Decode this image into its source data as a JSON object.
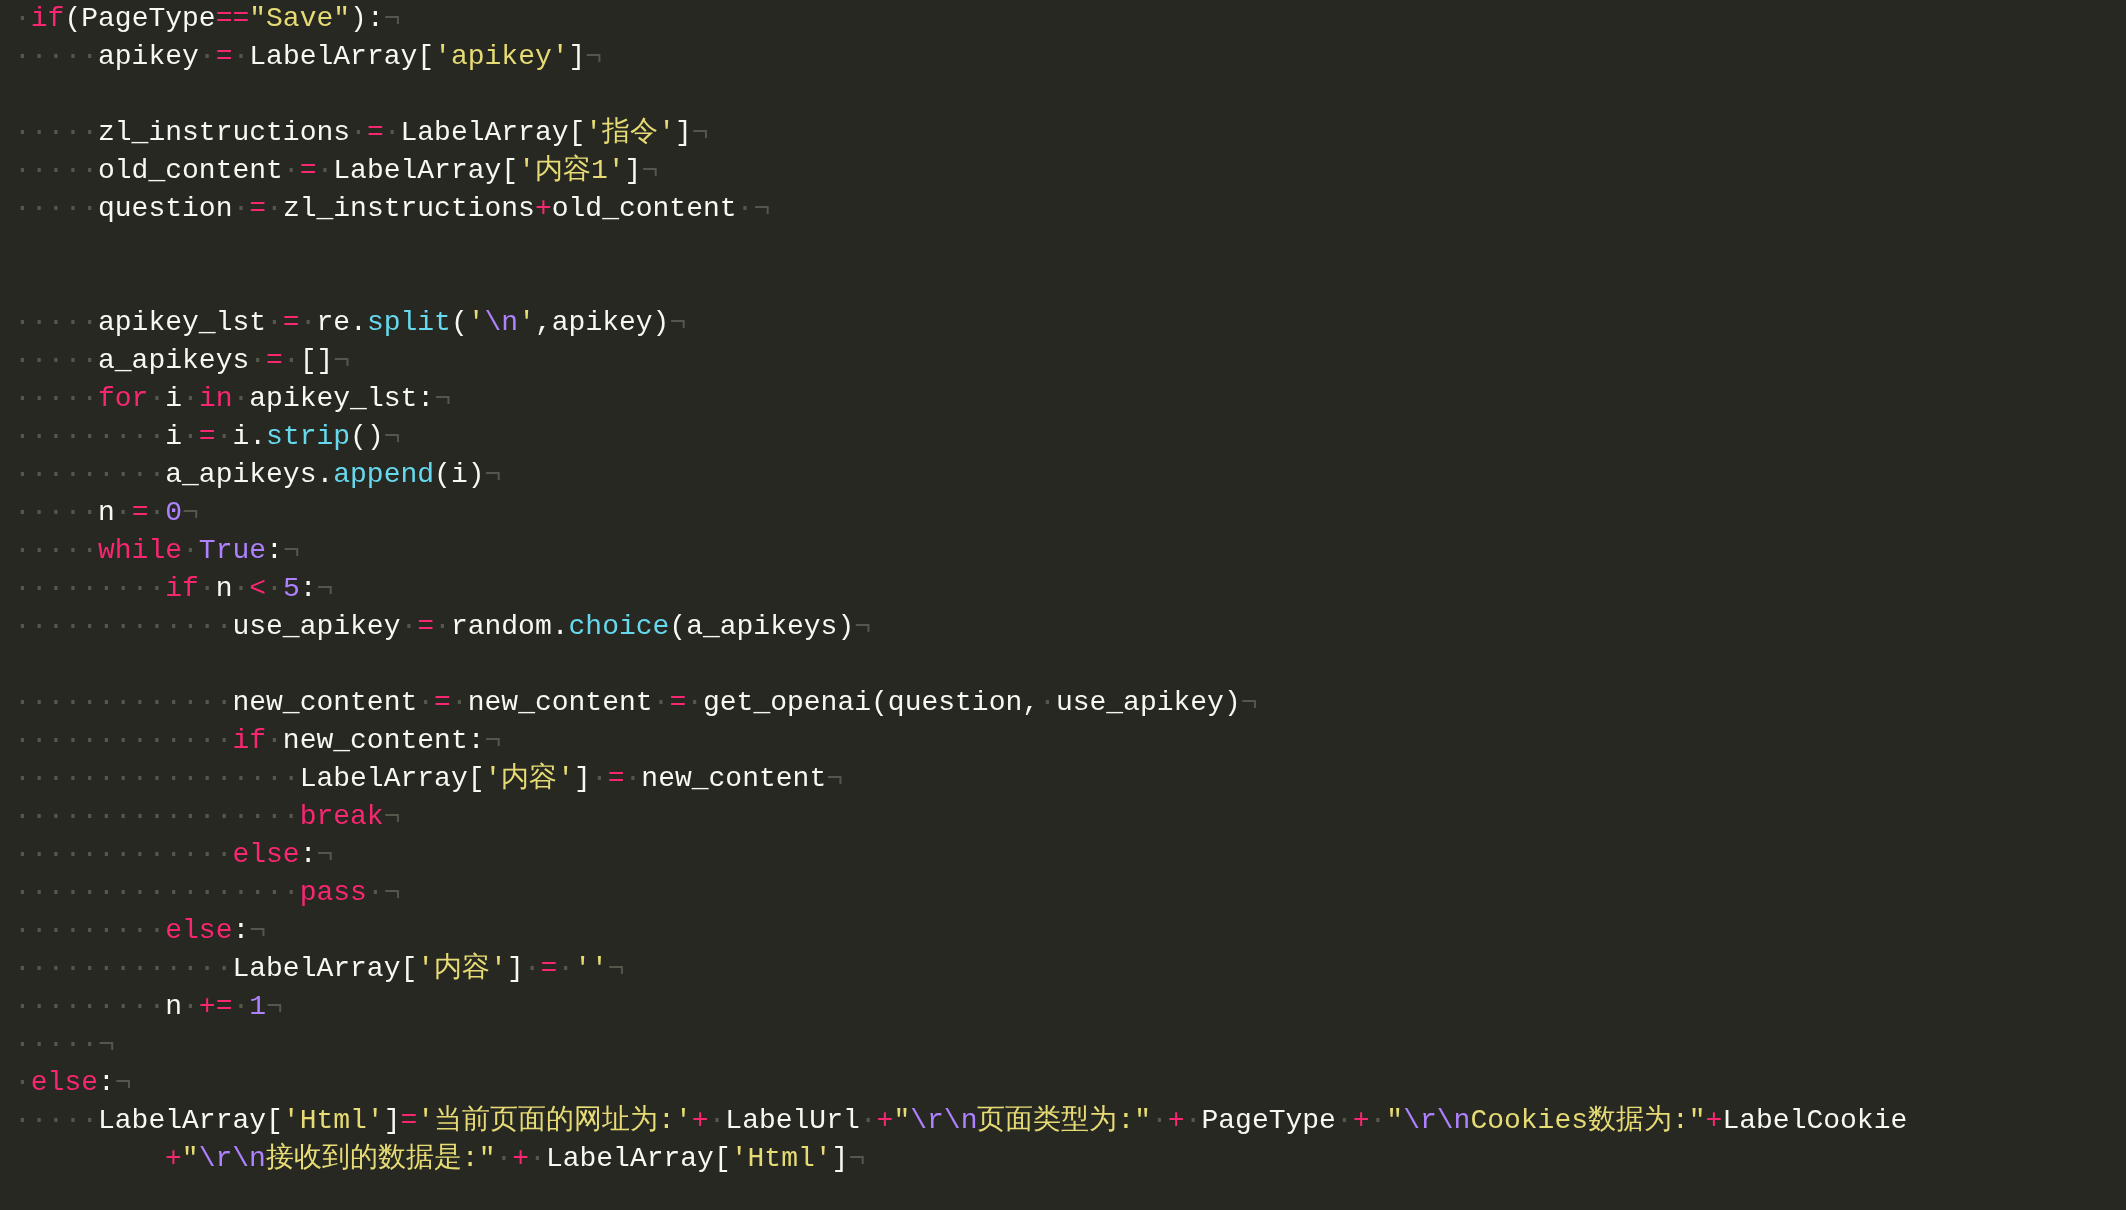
{
  "editor": {
    "lines": [
      {
        "kind": "code",
        "tokens": [
          {
            "kind": "ws",
            "text": "·"
          },
          {
            "kind": "kw",
            "text": "if"
          },
          {
            "kind": "txt",
            "text": "(PageType"
          },
          {
            "kind": "kw",
            "text": "=="
          },
          {
            "kind": "str",
            "text": "\"Save\""
          },
          {
            "kind": "txt",
            "text": "):"
          },
          {
            "kind": "eol",
            "text": "¬"
          }
        ]
      },
      {
        "kind": "code",
        "tokens": [
          {
            "kind": "ws",
            "text": "·····"
          },
          {
            "kind": "txt",
            "text": "apikey"
          },
          {
            "kind": "ws",
            "text": "·"
          },
          {
            "kind": "kw",
            "text": "="
          },
          {
            "kind": "ws",
            "text": "·"
          },
          {
            "kind": "txt",
            "text": "LabelArray["
          },
          {
            "kind": "str",
            "text": "'apikey'"
          },
          {
            "kind": "txt",
            "text": "]"
          },
          {
            "kind": "eol",
            "text": "¬"
          }
        ]
      },
      {
        "kind": "blank"
      },
      {
        "kind": "code",
        "tokens": [
          {
            "kind": "ws",
            "text": "·····"
          },
          {
            "kind": "txt",
            "text": "zl_instructions"
          },
          {
            "kind": "ws",
            "text": "·"
          },
          {
            "kind": "kw",
            "text": "="
          },
          {
            "kind": "ws",
            "text": "·"
          },
          {
            "kind": "txt",
            "text": "LabelArray["
          },
          {
            "kind": "str",
            "text": "'指令'"
          },
          {
            "kind": "txt",
            "text": "]"
          },
          {
            "kind": "eol",
            "text": "¬"
          }
        ]
      },
      {
        "kind": "code",
        "tokens": [
          {
            "kind": "ws",
            "text": "·····"
          },
          {
            "kind": "txt",
            "text": "old_content"
          },
          {
            "kind": "ws",
            "text": "·"
          },
          {
            "kind": "kw",
            "text": "="
          },
          {
            "kind": "ws",
            "text": "·"
          },
          {
            "kind": "txt",
            "text": "LabelArray["
          },
          {
            "kind": "str",
            "text": "'内容1'"
          },
          {
            "kind": "txt",
            "text": "]"
          },
          {
            "kind": "eol",
            "text": "¬"
          }
        ]
      },
      {
        "kind": "code",
        "tokens": [
          {
            "kind": "ws",
            "text": "·····"
          },
          {
            "kind": "txt",
            "text": "question"
          },
          {
            "kind": "ws",
            "text": "·"
          },
          {
            "kind": "kw",
            "text": "="
          },
          {
            "kind": "ws",
            "text": "·"
          },
          {
            "kind": "txt",
            "text": "zl_instructions"
          },
          {
            "kind": "kw",
            "text": "+"
          },
          {
            "kind": "txt",
            "text": "old_content"
          },
          {
            "kind": "ws",
            "text": "·"
          },
          {
            "kind": "eol",
            "text": "¬"
          }
        ]
      },
      {
        "kind": "blank"
      },
      {
        "kind": "blank"
      },
      {
        "kind": "code",
        "tokens": [
          {
            "kind": "ws",
            "text": "·····"
          },
          {
            "kind": "txt",
            "text": "apikey_lst"
          },
          {
            "kind": "ws",
            "text": "·"
          },
          {
            "kind": "kw",
            "text": "="
          },
          {
            "kind": "ws",
            "text": "·"
          },
          {
            "kind": "txt",
            "text": "re."
          },
          {
            "kind": "fn",
            "text": "split"
          },
          {
            "kind": "txt",
            "text": "("
          },
          {
            "kind": "str",
            "text": "'"
          },
          {
            "kind": "num",
            "text": "\\n"
          },
          {
            "kind": "str",
            "text": "'"
          },
          {
            "kind": "txt",
            "text": ",apikey)"
          },
          {
            "kind": "eol",
            "text": "¬"
          }
        ]
      },
      {
        "kind": "code",
        "tokens": [
          {
            "kind": "ws",
            "text": "·····"
          },
          {
            "kind": "txt",
            "text": "a_apikeys"
          },
          {
            "kind": "ws",
            "text": "·"
          },
          {
            "kind": "kw",
            "text": "="
          },
          {
            "kind": "ws",
            "text": "·"
          },
          {
            "kind": "txt",
            "text": "[]"
          },
          {
            "kind": "eol",
            "text": "¬"
          }
        ]
      },
      {
        "kind": "code",
        "tokens": [
          {
            "kind": "ws",
            "text": "·····"
          },
          {
            "kind": "kw",
            "text": "for"
          },
          {
            "kind": "ws",
            "text": "·"
          },
          {
            "kind": "txt",
            "text": "i"
          },
          {
            "kind": "ws",
            "text": "·"
          },
          {
            "kind": "kw",
            "text": "in"
          },
          {
            "kind": "ws",
            "text": "·"
          },
          {
            "kind": "txt",
            "text": "apikey_lst:"
          },
          {
            "kind": "eol",
            "text": "¬"
          }
        ]
      },
      {
        "kind": "code",
        "tokens": [
          {
            "kind": "ws",
            "text": "·········"
          },
          {
            "kind": "txt",
            "text": "i"
          },
          {
            "kind": "ws",
            "text": "·"
          },
          {
            "kind": "kw",
            "text": "="
          },
          {
            "kind": "ws",
            "text": "·"
          },
          {
            "kind": "txt",
            "text": "i."
          },
          {
            "kind": "fn",
            "text": "strip"
          },
          {
            "kind": "txt",
            "text": "()"
          },
          {
            "kind": "eol",
            "text": "¬"
          }
        ]
      },
      {
        "kind": "code",
        "tokens": [
          {
            "kind": "ws",
            "text": "·········"
          },
          {
            "kind": "txt",
            "text": "a_apikeys."
          },
          {
            "kind": "fn",
            "text": "append"
          },
          {
            "kind": "txt",
            "text": "(i)"
          },
          {
            "kind": "eol",
            "text": "¬"
          }
        ]
      },
      {
        "kind": "code",
        "tokens": [
          {
            "kind": "ws",
            "text": "·····"
          },
          {
            "kind": "txt",
            "text": "n"
          },
          {
            "kind": "ws",
            "text": "·"
          },
          {
            "kind": "kw",
            "text": "="
          },
          {
            "kind": "ws",
            "text": "·"
          },
          {
            "kind": "num",
            "text": "0"
          },
          {
            "kind": "eol",
            "text": "¬"
          }
        ]
      },
      {
        "kind": "code",
        "tokens": [
          {
            "kind": "ws",
            "text": "·····"
          },
          {
            "kind": "kw",
            "text": "while"
          },
          {
            "kind": "ws",
            "text": "·"
          },
          {
            "kind": "num",
            "text": "True"
          },
          {
            "kind": "txt",
            "text": ":"
          },
          {
            "kind": "eol",
            "text": "¬"
          }
        ]
      },
      {
        "kind": "code",
        "tokens": [
          {
            "kind": "ws",
            "text": "·········"
          },
          {
            "kind": "kw",
            "text": "if"
          },
          {
            "kind": "ws",
            "text": "·"
          },
          {
            "kind": "txt",
            "text": "n"
          },
          {
            "kind": "ws",
            "text": "·"
          },
          {
            "kind": "kw",
            "text": "<"
          },
          {
            "kind": "ws",
            "text": "·"
          },
          {
            "kind": "num",
            "text": "5"
          },
          {
            "kind": "txt",
            "text": ":"
          },
          {
            "kind": "eol",
            "text": "¬"
          }
        ]
      },
      {
        "kind": "code",
        "tokens": [
          {
            "kind": "ws",
            "text": "·············"
          },
          {
            "kind": "txt",
            "text": "use_apikey"
          },
          {
            "kind": "ws",
            "text": "·"
          },
          {
            "kind": "kw",
            "text": "="
          },
          {
            "kind": "ws",
            "text": "·"
          },
          {
            "kind": "txt",
            "text": "random."
          },
          {
            "kind": "fn",
            "text": "choice"
          },
          {
            "kind": "txt",
            "text": "(a_apikeys)"
          },
          {
            "kind": "eol",
            "text": "¬"
          }
        ]
      },
      {
        "kind": "blank"
      },
      {
        "kind": "code",
        "tokens": [
          {
            "kind": "ws",
            "text": "·············"
          },
          {
            "kind": "txt",
            "text": "new_content"
          },
          {
            "kind": "ws",
            "text": "·"
          },
          {
            "kind": "kw",
            "text": "="
          },
          {
            "kind": "ws",
            "text": "·"
          },
          {
            "kind": "txt",
            "text": "new_content"
          },
          {
            "kind": "ws",
            "text": "·"
          },
          {
            "kind": "kw",
            "text": "="
          },
          {
            "kind": "ws",
            "text": "·"
          },
          {
            "kind": "txt",
            "text": "get_openai(question,"
          },
          {
            "kind": "ws",
            "text": "·"
          },
          {
            "kind": "txt",
            "text": "use_apikey)"
          },
          {
            "kind": "eol",
            "text": "¬"
          }
        ]
      },
      {
        "kind": "code",
        "tokens": [
          {
            "kind": "ws",
            "text": "·············"
          },
          {
            "kind": "kw",
            "text": "if"
          },
          {
            "kind": "ws",
            "text": "·"
          },
          {
            "kind": "txt",
            "text": "new_content:"
          },
          {
            "kind": "eol",
            "text": "¬"
          }
        ]
      },
      {
        "kind": "code",
        "tokens": [
          {
            "kind": "ws",
            "text": "·················"
          },
          {
            "kind": "txt",
            "text": "LabelArray["
          },
          {
            "kind": "str",
            "text": "'内容'"
          },
          {
            "kind": "txt",
            "text": "]"
          },
          {
            "kind": "ws",
            "text": "·"
          },
          {
            "kind": "kw",
            "text": "="
          },
          {
            "kind": "ws",
            "text": "·"
          },
          {
            "kind": "txt",
            "text": "new_content"
          },
          {
            "kind": "eol",
            "text": "¬"
          }
        ]
      },
      {
        "kind": "code",
        "tokens": [
          {
            "kind": "ws",
            "text": "·················"
          },
          {
            "kind": "kw",
            "text": "break"
          },
          {
            "kind": "eol",
            "text": "¬"
          }
        ]
      },
      {
        "kind": "code",
        "tokens": [
          {
            "kind": "ws",
            "text": "·············"
          },
          {
            "kind": "kw",
            "text": "else"
          },
          {
            "kind": "txt",
            "text": ":"
          },
          {
            "kind": "eol",
            "text": "¬"
          }
        ]
      },
      {
        "kind": "code",
        "tokens": [
          {
            "kind": "ws",
            "text": "·················"
          },
          {
            "kind": "kw",
            "text": "pass"
          },
          {
            "kind": "ws",
            "text": "·"
          },
          {
            "kind": "eol",
            "text": "¬"
          }
        ]
      },
      {
        "kind": "code",
        "tokens": [
          {
            "kind": "ws",
            "text": "·········"
          },
          {
            "kind": "kw",
            "text": "else"
          },
          {
            "kind": "txt",
            "text": ":"
          },
          {
            "kind": "eol",
            "text": "¬"
          }
        ]
      },
      {
        "kind": "code",
        "tokens": [
          {
            "kind": "ws",
            "text": "·············"
          },
          {
            "kind": "txt",
            "text": "LabelArray["
          },
          {
            "kind": "str",
            "text": "'内容'"
          },
          {
            "kind": "txt",
            "text": "]"
          },
          {
            "kind": "ws",
            "text": "·"
          },
          {
            "kind": "kw",
            "text": "="
          },
          {
            "kind": "ws",
            "text": "·"
          },
          {
            "kind": "str",
            "text": "''"
          },
          {
            "kind": "eol",
            "text": "¬"
          }
        ]
      },
      {
        "kind": "code",
        "tokens": [
          {
            "kind": "ws",
            "text": "·········"
          },
          {
            "kind": "txt",
            "text": "n"
          },
          {
            "kind": "ws",
            "text": "·"
          },
          {
            "kind": "kw",
            "text": "+="
          },
          {
            "kind": "ws",
            "text": "·"
          },
          {
            "kind": "num",
            "text": "1"
          },
          {
            "kind": "eol",
            "text": "¬"
          }
        ]
      },
      {
        "kind": "code",
        "tokens": [
          {
            "kind": "ws",
            "text": "·····"
          },
          {
            "kind": "eol",
            "text": "¬"
          }
        ]
      },
      {
        "kind": "code",
        "tokens": [
          {
            "kind": "ws",
            "text": "·"
          },
          {
            "kind": "kw",
            "text": "else"
          },
          {
            "kind": "txt",
            "text": ":"
          },
          {
            "kind": "eol",
            "text": "¬"
          }
        ]
      },
      {
        "kind": "code",
        "tokens": [
          {
            "kind": "ws",
            "text": "·····"
          },
          {
            "kind": "txt",
            "text": "LabelArray["
          },
          {
            "kind": "str",
            "text": "'Html'"
          },
          {
            "kind": "txt",
            "text": "]"
          },
          {
            "kind": "kw",
            "text": "="
          },
          {
            "kind": "str",
            "text": "'当前页面的网址为:'"
          },
          {
            "kind": "kw",
            "text": "+"
          },
          {
            "kind": "ws",
            "text": "·"
          },
          {
            "kind": "txt",
            "text": "LabelUrl"
          },
          {
            "kind": "ws",
            "text": "·"
          },
          {
            "kind": "kw",
            "text": "+"
          },
          {
            "kind": "str",
            "text": "\""
          },
          {
            "kind": "num",
            "text": "\\r\\n"
          },
          {
            "kind": "str",
            "text": "页面类型为:\""
          },
          {
            "kind": "ws",
            "text": "·"
          },
          {
            "kind": "kw",
            "text": "+"
          },
          {
            "kind": "ws",
            "text": "·"
          },
          {
            "kind": "txt",
            "text": "PageType"
          },
          {
            "kind": "ws",
            "text": "·"
          },
          {
            "kind": "kw",
            "text": "+"
          },
          {
            "kind": "ws",
            "text": "·"
          },
          {
            "kind": "str",
            "text": "\""
          },
          {
            "kind": "num",
            "text": "\\r\\n"
          },
          {
            "kind": "str",
            "text": "Cookies数据为:\""
          },
          {
            "kind": "kw",
            "text": "+"
          },
          {
            "kind": "txt",
            "text": "LabelCookie"
          }
        ]
      },
      {
        "kind": "wrap",
        "tokens": [
          {
            "kind": "kw",
            "text": "+"
          },
          {
            "kind": "str",
            "text": "\""
          },
          {
            "kind": "num",
            "text": "\\r\\n"
          },
          {
            "kind": "str",
            "text": "接收到的数据是:\""
          },
          {
            "kind": "ws",
            "text": "·"
          },
          {
            "kind": "kw",
            "text": "+"
          },
          {
            "kind": "ws",
            "text": "·"
          },
          {
            "kind": "txt",
            "text": "LabelArray["
          },
          {
            "kind": "str",
            "text": "'Html'"
          },
          {
            "kind": "txt",
            "text": "]"
          },
          {
            "kind": "eol",
            "text": "¬"
          }
        ]
      }
    ]
  }
}
